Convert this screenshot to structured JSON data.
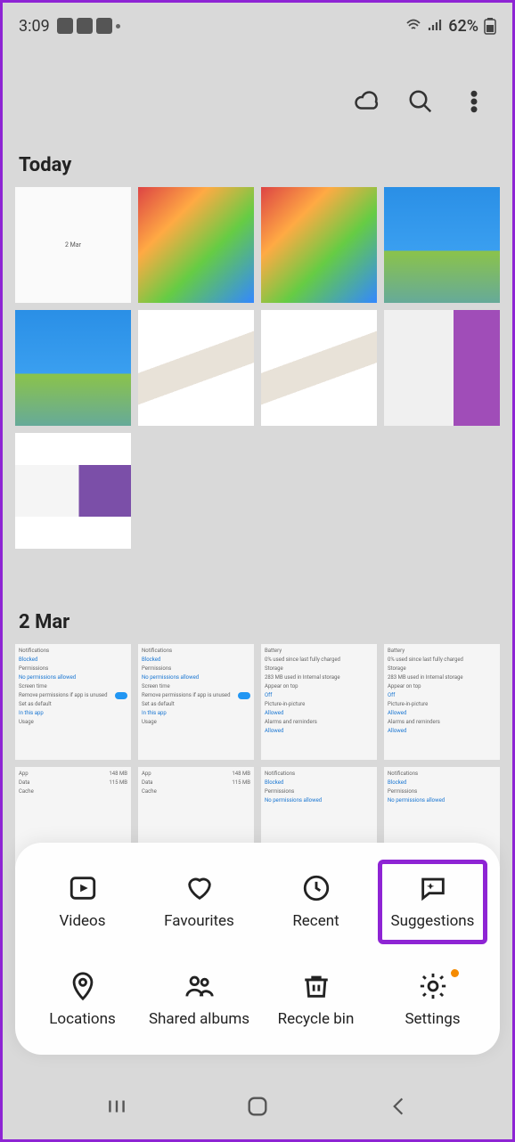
{
  "status": {
    "time": "3:09",
    "battery": "62%"
  },
  "sections": {
    "today": "Today",
    "mar2": "2 Mar"
  },
  "sheet": {
    "items": [
      {
        "label": "Videos"
      },
      {
        "label": "Favourites"
      },
      {
        "label": "Recent"
      },
      {
        "label": "Suggestions"
      },
      {
        "label": "Locations"
      },
      {
        "label": "Shared albums"
      },
      {
        "label": "Recycle bin"
      },
      {
        "label": "Settings"
      }
    ]
  },
  "settings_thumb": {
    "notifications": "Notifications",
    "blocked": "Blocked",
    "permissions": "Permissions",
    "no_perm": "No permissions allowed",
    "screen_time": "Screen time",
    "remove_perm": "Remove permissions if app is unused",
    "set_default": "Set as default",
    "in_this_app": "In this app",
    "usage": "Usage",
    "app": "App",
    "data": "Data",
    "cache": "Cache",
    "battery": "Battery",
    "battery_sub": "0% used since last fully charged",
    "storage": "Storage",
    "storage_sub": "283 MB used in Internal storage",
    "appear_on_top": "Appear on top",
    "off": "Off",
    "pip": "Picture-in-picture",
    "allowed": "Allowed",
    "alarms": "Alarms and reminders",
    "app_size": "148 MB",
    "data_size": "115 MB"
  }
}
